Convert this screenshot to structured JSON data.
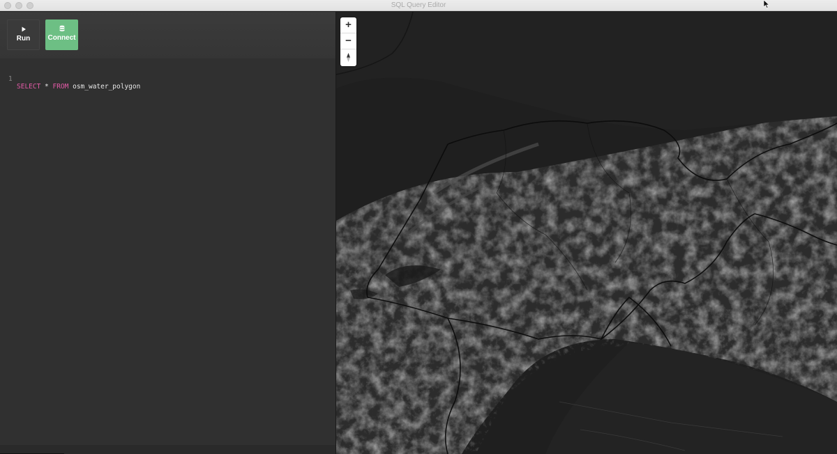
{
  "window": {
    "title": "SQL Query Editor"
  },
  "toolbar": {
    "run_label": "Run",
    "connect_label": "Connect",
    "connect_color": "#6dbf84"
  },
  "editor": {
    "lines": [
      {
        "number": "1",
        "keyword1": "SELECT",
        "star": " * ",
        "keyword2": "FROM",
        "rest": " osm_water_polygon"
      }
    ],
    "keyword_color": "#e25aa6"
  },
  "map": {
    "zoom_in": "+",
    "zoom_out": "−",
    "icons": [
      "plus-icon",
      "minus-icon",
      "compass-icon"
    ],
    "style": "dark terrain hillshade"
  }
}
